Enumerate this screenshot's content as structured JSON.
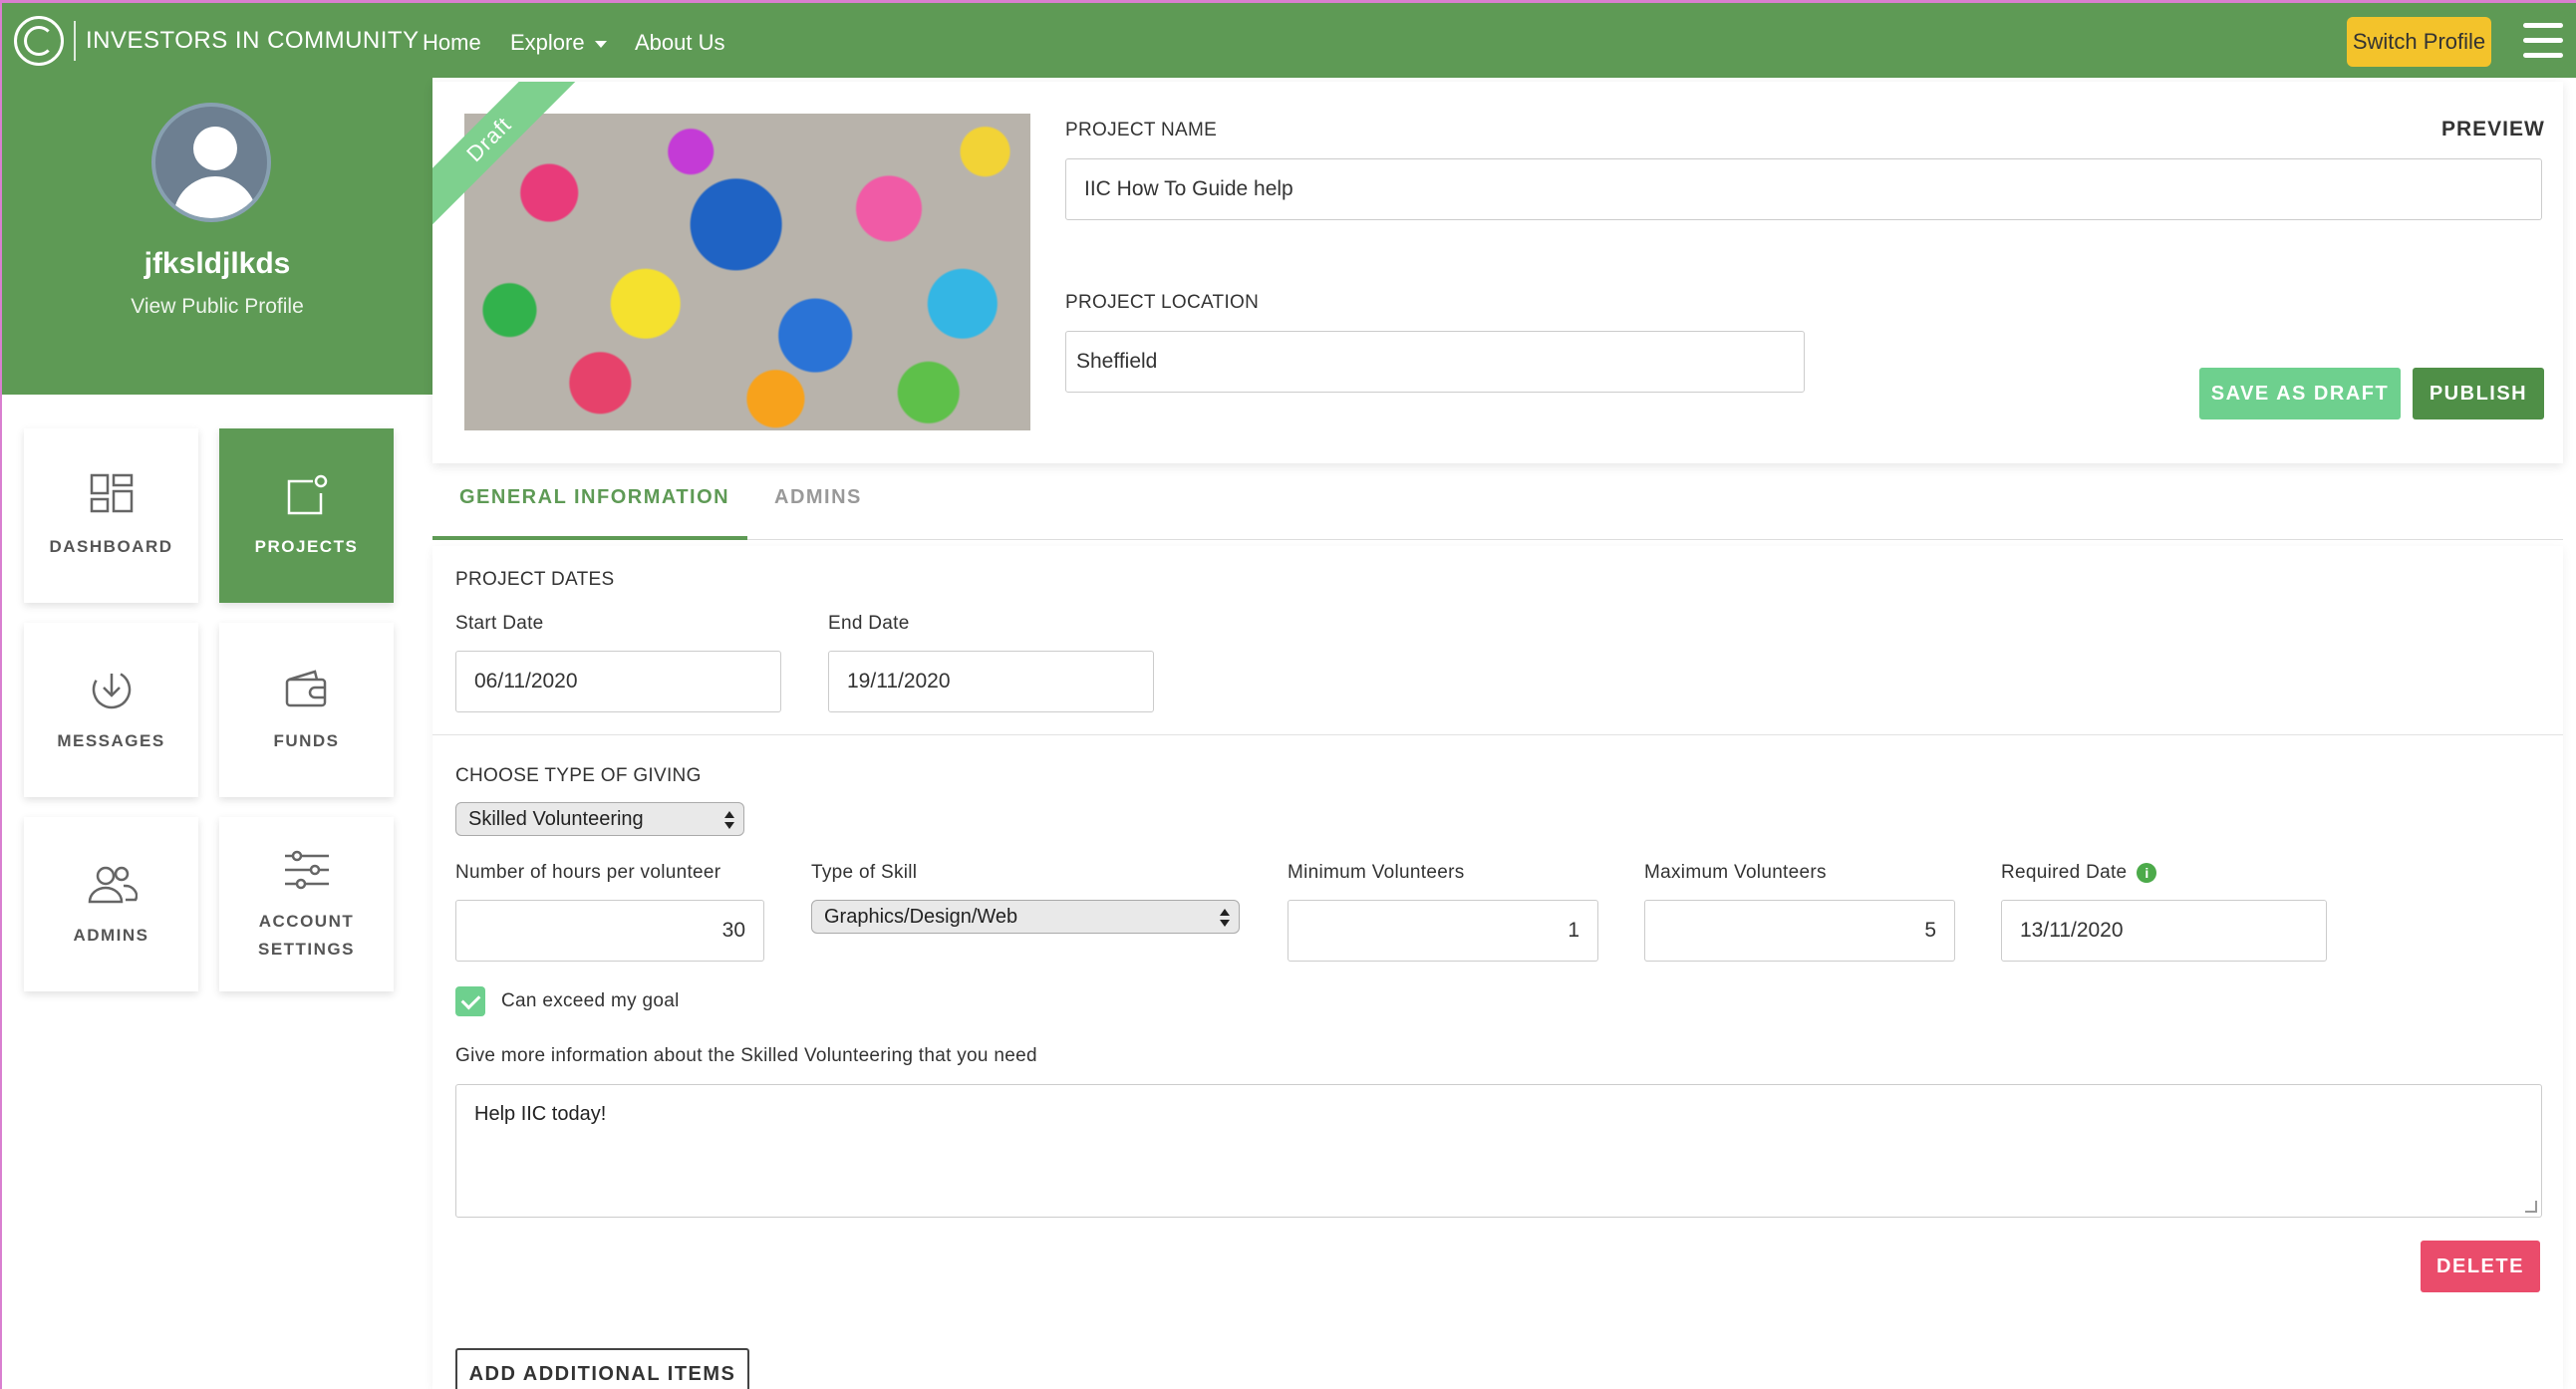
{
  "nav": {
    "brand": "INVESTORS IN COMMUNITY",
    "links": [
      "Home",
      "Explore",
      "About Us"
    ],
    "switch_profile": "Switch Profile"
  },
  "profile": {
    "username": "jfksldjlkds",
    "view_public_profile": "View Public Profile"
  },
  "sidebar": {
    "items": [
      {
        "label": "DASHBOARD",
        "icon": "dashboard-icon",
        "active": false
      },
      {
        "label": "PROJECTS",
        "icon": "projects-icon",
        "active": true
      },
      {
        "label": "MESSAGES",
        "icon": "messages-icon",
        "active": false
      },
      {
        "label": "FUNDS",
        "icon": "wallet-icon",
        "active": false
      },
      {
        "label": "ADMINS",
        "icon": "admins-icon",
        "active": false
      },
      {
        "label": "ACCOUNT",
        "label2": "SETTINGS",
        "icon": "sliders-icon",
        "active": false
      }
    ]
  },
  "project": {
    "status_ribbon": "Draft",
    "name_label": "PROJECT NAME",
    "name_value": "IIC How To Guide help",
    "preview": "PREVIEW",
    "location_label": "PROJECT LOCATION",
    "location_value": "Sheffield",
    "save_draft": "SAVE AS DRAFT",
    "publish": "PUBLISH"
  },
  "tabs": [
    {
      "label": "GENERAL INFORMATION",
      "active": true
    },
    {
      "label": "ADMINS",
      "active": false
    }
  ],
  "dates": {
    "section_title": "PROJECT DATES",
    "start_label": "Start Date",
    "start_value": "06/11/2020",
    "end_label": "End Date",
    "end_value": "19/11/2020"
  },
  "giving": {
    "section_title": "CHOOSE TYPE OF GIVING",
    "type_selected": "Skilled Volunteering",
    "hours_label": "Number of hours per volunteer",
    "hours_value": "30",
    "skill_label": "Type of Skill",
    "skill_selected": "Graphics/Design/Web",
    "min_label": "Minimum Volunteers",
    "min_value": "1",
    "max_label": "Maximum Volunteers",
    "max_value": "5",
    "required_label": "Required Date",
    "required_value": "13/11/2020",
    "exceed_label": "Can exceed my goal",
    "exceed_checked": true,
    "info_label": "Give more information about the Skilled Volunteering that you need",
    "info_value": "Help IIC today!",
    "delete": "DELETE"
  },
  "add_items": "ADD ADDITIONAL ITEMS",
  "colors": {
    "brand_green": "#5e9a55",
    "accent_yellow": "#f3c32b",
    "draft_green": "#6ed08e",
    "publish_green": "#4f8f47",
    "delete_red": "#ea4c6b"
  }
}
